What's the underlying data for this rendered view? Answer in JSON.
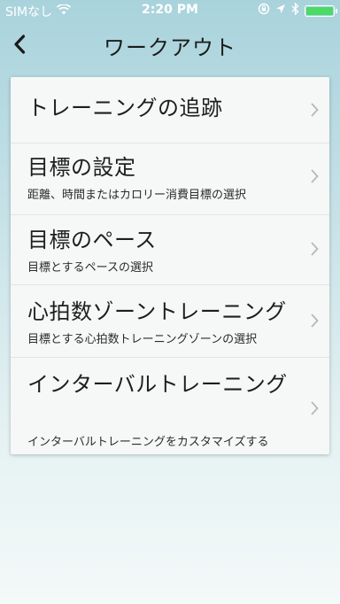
{
  "status_bar": {
    "carrier": "SIMなし",
    "time": "2:20 PM",
    "battery_color": "#4cd964",
    "battery_level_percent": 100
  },
  "nav": {
    "title": "ワークアウト"
  },
  "menu": {
    "items": [
      {
        "title": "トレーニングの追跡",
        "subtitle": ""
      },
      {
        "title": "目標の設定",
        "subtitle": "距離、時間またはカロリー消費目標の選択"
      },
      {
        "title": "目標のペース",
        "subtitle": "目標とするペースの選択"
      },
      {
        "title": "心拍数ゾーントレーニング",
        "subtitle": "目標とする心拍数トレーニングゾーンの選択"
      },
      {
        "title": "インターバルトレーニング",
        "subtitle": "インターバルトレーニングをカスタマイズする"
      }
    ]
  }
}
